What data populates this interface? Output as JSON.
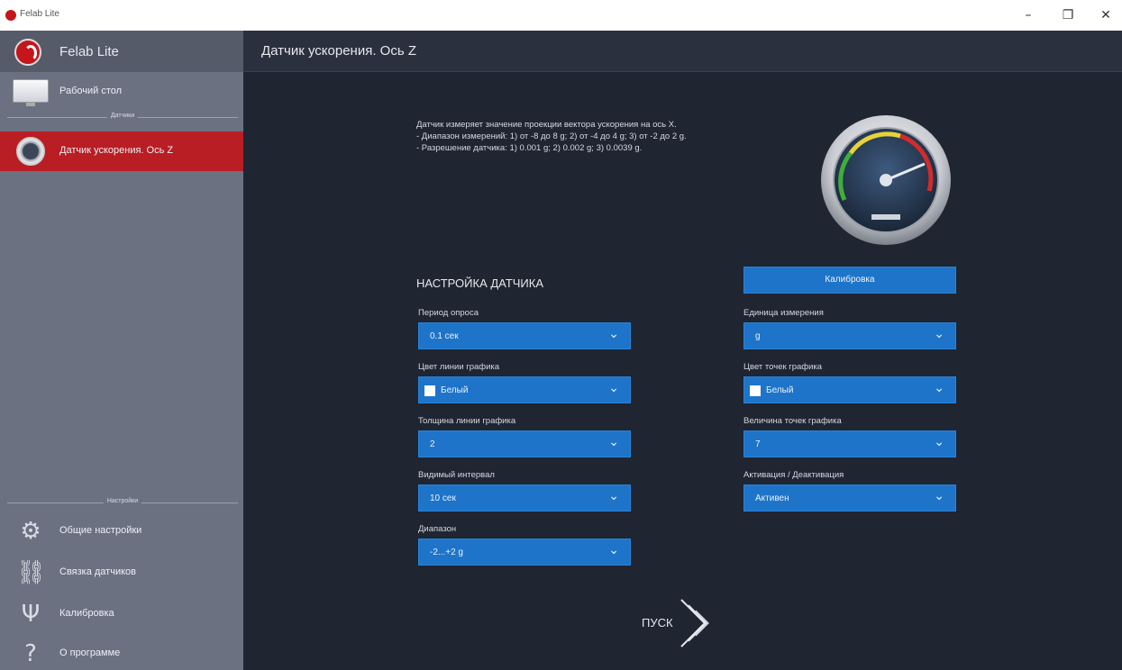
{
  "window": {
    "title": "Felab Lite",
    "minimize": "–",
    "maximize": "❐",
    "close": "✕"
  },
  "sidebar": {
    "app_name": "Felab Lite",
    "items": [
      {
        "label": "Рабочий стол",
        "icon": "desktop-icon"
      },
      {
        "label": "Датчик ускорения. Ось Z",
        "icon": "gauge-icon",
        "active": true
      }
    ],
    "section_sensors": "Датчики",
    "section_settings": "Настройки",
    "bottom_items": [
      {
        "label": "Общие настройки",
        "icon": "settings-icon"
      },
      {
        "label": "Связка датчиков",
        "icon": "link-icon"
      },
      {
        "label": "Калибровка",
        "icon": "calibration-icon"
      },
      {
        "label": "О программе",
        "icon": "help-icon"
      }
    ]
  },
  "main": {
    "title": "Датчик ускорения. Ось Z",
    "description": [
      "Датчик измеряет значение проекции вектора ускорения на ось Х.",
      "- Диапазон измерений: 1) от -8 до 8 g; 2) от -4 до 4 g; 3) от -2 до 2 g.",
      "- Разрешение датчика: 1) 0.001 g; 2) 0.002 g; 3) 0.0039 g."
    ],
    "section_title": "НАСТРОЙКА ДАТЧИКА",
    "calibrate_button": "Калибровка",
    "fields_left": [
      {
        "label": "Период опроса",
        "value": "0.1 сек"
      },
      {
        "label": "Цвет линии графика",
        "value": "Белый",
        "swatch": "#ffffff"
      },
      {
        "label": "Толщина линии графика",
        "value": "2"
      },
      {
        "label": "Видимый интервал",
        "value": "10 сек"
      },
      {
        "label": "Диапазон",
        "value": "-2...+2 g"
      }
    ],
    "fields_right": [
      {
        "label": "Единица измерения",
        "value": "g"
      },
      {
        "label": "Цвет точек графика",
        "value": "Белый",
        "swatch": "#ffffff"
      },
      {
        "label": "Величина точек графика",
        "value": "7"
      },
      {
        "label": "Активация / Деактивация",
        "value": "Активен"
      }
    ],
    "start_label": "ПУСК"
  },
  "colors": {
    "sidebar_bg": "#6b7181",
    "active_item": "#b81e24",
    "main_bg": "#1f2531",
    "accent_blue": "#1e74c9"
  }
}
